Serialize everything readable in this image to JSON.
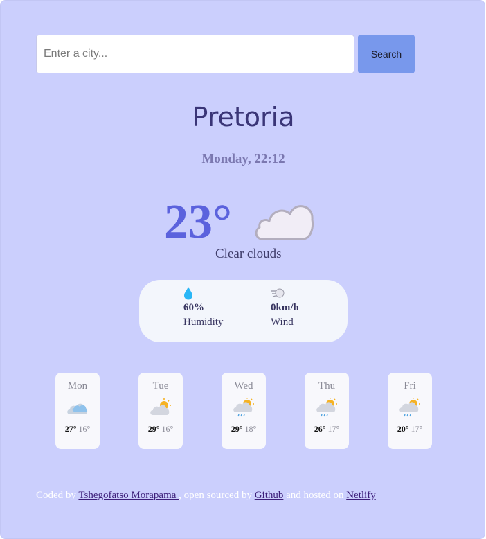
{
  "search": {
    "placeholder": "Enter a city...",
    "value": "",
    "button_label": "Search"
  },
  "current": {
    "city": "Pretoria",
    "datetime": "Monday, 22:12",
    "temperature": "23°",
    "description": "Clear clouds",
    "icon": "cloud-icon",
    "humidity_value": "60%",
    "humidity_label": "Humidity",
    "wind_value": "0km/h",
    "wind_label": "Wind"
  },
  "forecast": [
    {
      "day": "Mon",
      "max": "27°",
      "min": "16°",
      "icon": "partly-cloudy-icon"
    },
    {
      "day": "Tue",
      "max": "29°",
      "min": "16°",
      "icon": "sun-behind-cloud-icon"
    },
    {
      "day": "Wed",
      "max": "29°",
      "min": "18°",
      "icon": "sun-cloud-rain-icon"
    },
    {
      "day": "Thu",
      "max": "26°",
      "min": "17°",
      "icon": "sun-cloud-rain-icon"
    },
    {
      "day": "Fri",
      "max": "20°",
      "min": "17°",
      "icon": "sun-cloud-rain-icon"
    }
  ],
  "footer": {
    "text_1": "Coded by ",
    "author_link": "Tshegofatso Morapama ",
    "text_2": ", open sourced by ",
    "github_link": "Github",
    "text_3": " and hosted on ",
    "netlify_link": "Netlify"
  },
  "colors": {
    "background": "#cbcffd",
    "accent": "#5b62dd",
    "button": "#7898ec",
    "city_text": "#3a3577",
    "card": "#f8f8fc"
  }
}
